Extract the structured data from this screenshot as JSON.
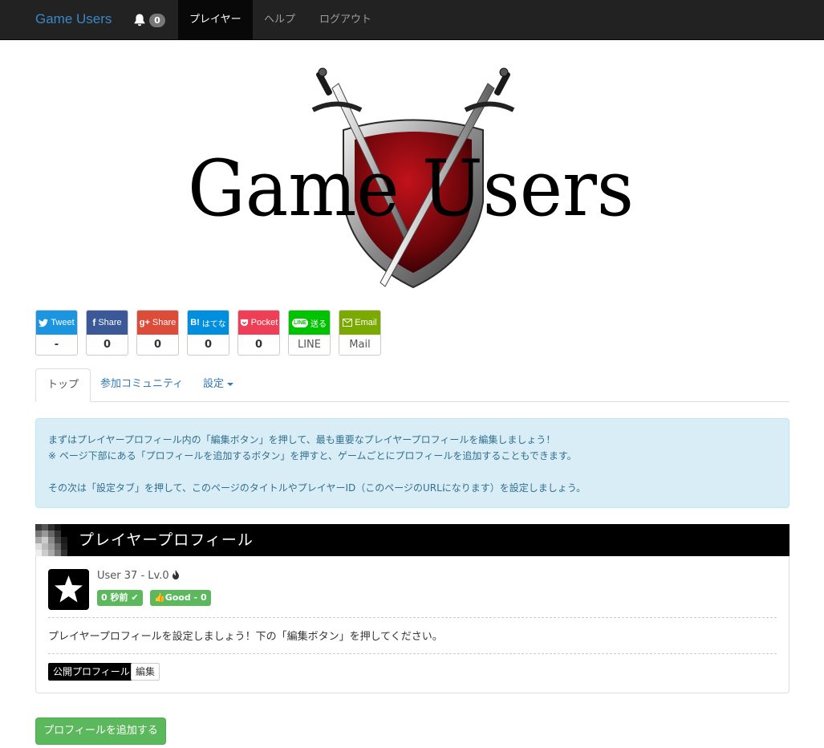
{
  "navbar": {
    "brand": "Game Users",
    "notification_count": "0",
    "items": [
      {
        "label": "プレイヤー",
        "active": true
      },
      {
        "label": "ヘルプ",
        "active": false
      },
      {
        "label": "ログアウト",
        "active": false
      }
    ]
  },
  "logo": {
    "text": "Game Users"
  },
  "share": [
    {
      "label": "Tweet",
      "icon": "twitter-icon",
      "count": "-",
      "color": "#1b95e0"
    },
    {
      "label": "Share",
      "icon": "facebook-icon",
      "count": "0",
      "color": "#3b5998"
    },
    {
      "label": "Share",
      "icon": "google-plus-icon",
      "icon_text": "g+",
      "count": "0",
      "color": "#dd4b39"
    },
    {
      "label": "はてな",
      "icon": "hatena-icon",
      "icon_text": "B!",
      "count": "0",
      "color": "#008fde"
    },
    {
      "label": "Pocket",
      "icon": "pocket-icon",
      "count": "0",
      "color": "#ef3f56"
    },
    {
      "label": "送る",
      "icon": "line-icon",
      "icon_text": "LINE",
      "count": "LINE",
      "color": "#00c300"
    },
    {
      "label": "Email",
      "icon": "mail-icon",
      "count": "Mail",
      "color": "#7aa900"
    }
  ],
  "tabs": [
    {
      "label": "トップ",
      "active": true
    },
    {
      "label": "参加コミュニティ",
      "active": false
    },
    {
      "label": "設定",
      "active": false,
      "dropdown": true
    }
  ],
  "alert": {
    "line1": "まずはプレイヤープロフィール内の「編集ボタン」を押して、最も重要なプレイヤープロフィールを編集しましょう！",
    "line2": "※ ページ下部にある「プロフィールを追加するボタン」を押すと、ゲームごとにプロフィールを追加することもできます。",
    "line3": "その次は「設定タブ」を押して、このページのタイトルやプレイヤーID（このページのURLになります）を設定しましょう。"
  },
  "profile": {
    "heading": "プレイヤープロフィール",
    "user": "User 37 - Lv.0",
    "time_label": "0 秒前",
    "good_label": "Good - 0",
    "message": "プレイヤープロフィールを設定しましょう！下の「編集ボタン」を押してください。",
    "public_tag": "公開プロフィール",
    "edit_button": "編集"
  },
  "add_profile_button": "プロフィールを追加する"
}
